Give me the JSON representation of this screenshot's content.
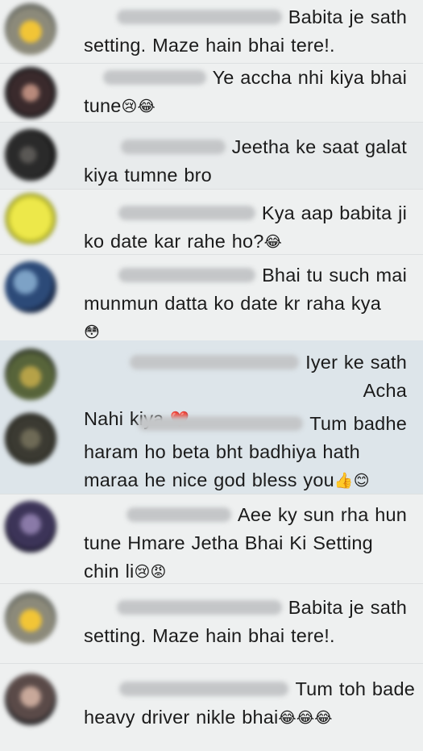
{
  "colors": {
    "background": "#eef0f0",
    "text": "#1b1b1b",
    "highlight_band": "#dde5ea"
  },
  "comments": [
    {
      "line1": "Babita je sath",
      "line2": "setting. Maze hain bhai tere!.",
      "line3": "",
      "emoji": "",
      "avatar_icon": "yellow-avatar-icon"
    },
    {
      "line1": "Ye accha nhi kiya bhai",
      "line2": "tune",
      "line3": "",
      "emoji": "😢😂",
      "avatar_icon": "photo-avatar-icon"
    },
    {
      "line1": "Jeetha ke saat galat",
      "line2": "kiya tumne bro",
      "line3": "",
      "emoji": "",
      "avatar_icon": "photo-avatar-icon"
    },
    {
      "line1": "Kya aap babita ji",
      "line2": "ko date kar rahe ho?",
      "line3": "",
      "emoji": "😂",
      "avatar_icon": "smiley-avatar-icon"
    },
    {
      "line1": "Bhai tu such mai",
      "line2": "munmun datta ko date kr raha kya",
      "line3": "",
      "emoji": "😳",
      "avatar_icon": "photo-avatar-icon"
    },
    {
      "line1": "Iyer ke sath Acha",
      "line2": "Nahi kiya",
      "line3": "",
      "emoji": "❤️",
      "avatar_icon": "photo-avatar-icon"
    },
    {
      "line1": "Tum badhe",
      "line2": "haram ho beta bht badhiya hath",
      "line3": "maraa he nice god bless you",
      "emoji": "👍😊",
      "avatar_icon": "photo-avatar-icon"
    },
    {
      "line1": "Aee ky sun rha hun",
      "line2": "tune Hmare Jetha Bhai Ki Setting",
      "line3": "chin li",
      "emoji": "😢😡",
      "avatar_icon": "photo-avatar-icon"
    },
    {
      "line1": "Babita je sath",
      "line2": "setting. Maze hain bhai tere!.",
      "line3": "",
      "emoji": "",
      "avatar_icon": "yellow-avatar-icon"
    },
    {
      "line1": "Tum toh bade",
      "line2": "heavy driver nikle bhai",
      "line3": "",
      "emoji": "😂😂😂",
      "avatar_icon": "photo-avatar-icon"
    }
  ]
}
